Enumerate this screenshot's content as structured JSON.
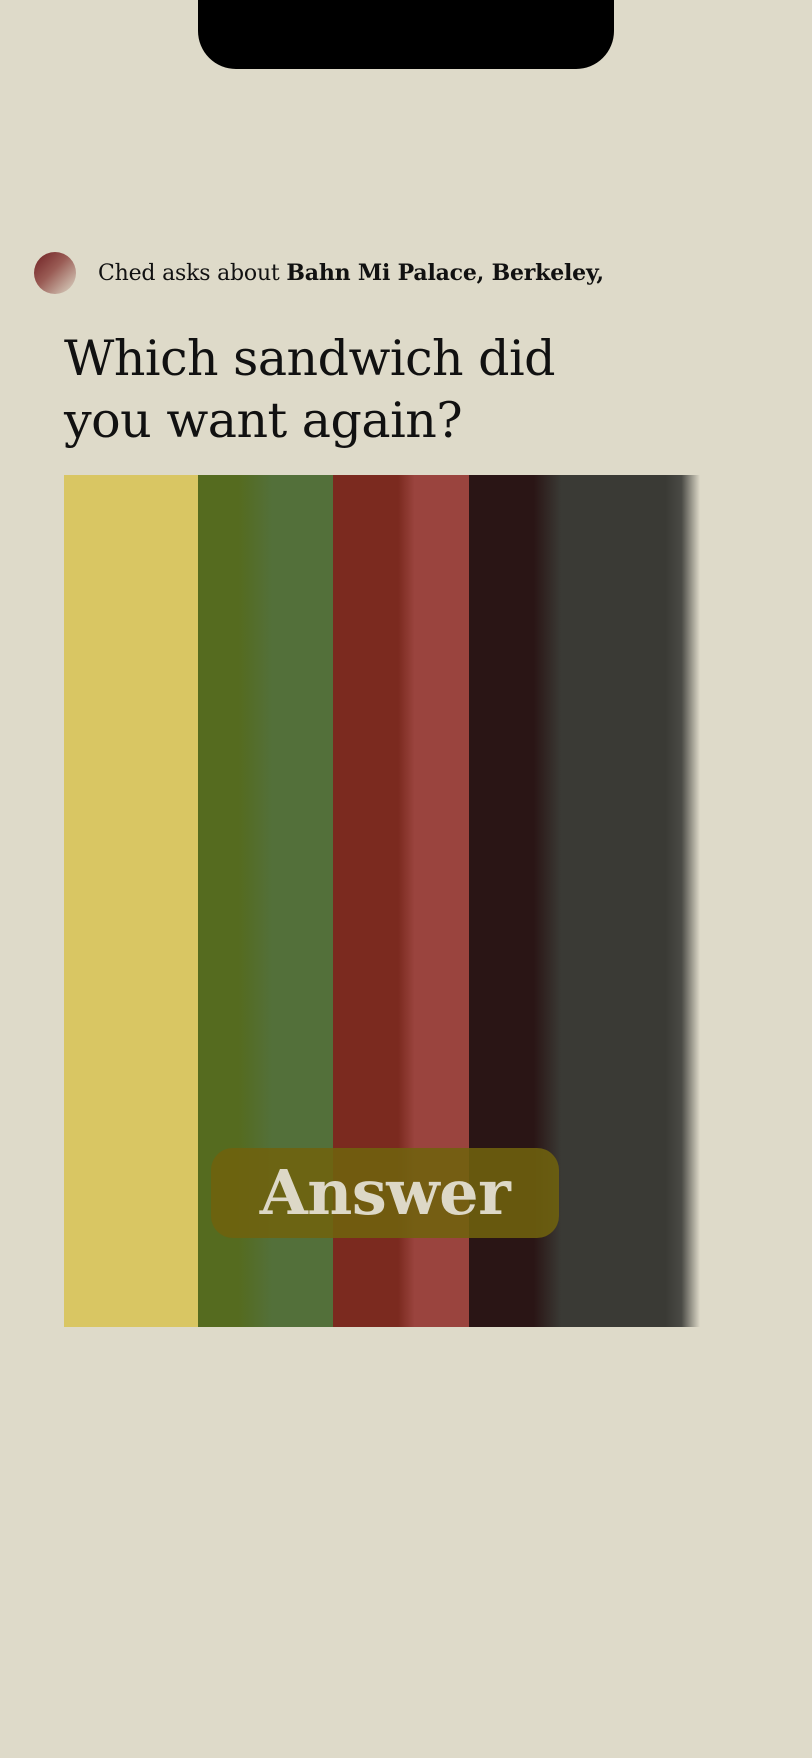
{
  "asker": {
    "prefix": "Ched asks about ",
    "place": "Bahn Mi Palace, Berkeley,"
  },
  "question": {
    "line1": "Which sandwich did",
    "line2": "you want again?"
  },
  "answer_button": {
    "label": "Answer"
  },
  "colors": {
    "background": "#dedac9",
    "stripe_yellow": "#d9c663",
    "stripe_green": "#53703a",
    "stripe_red": "#9a443e",
    "stripe_dark": "#3a3a35",
    "button_bg": "#6f620e",
    "button_text": "#ddd8c7"
  }
}
